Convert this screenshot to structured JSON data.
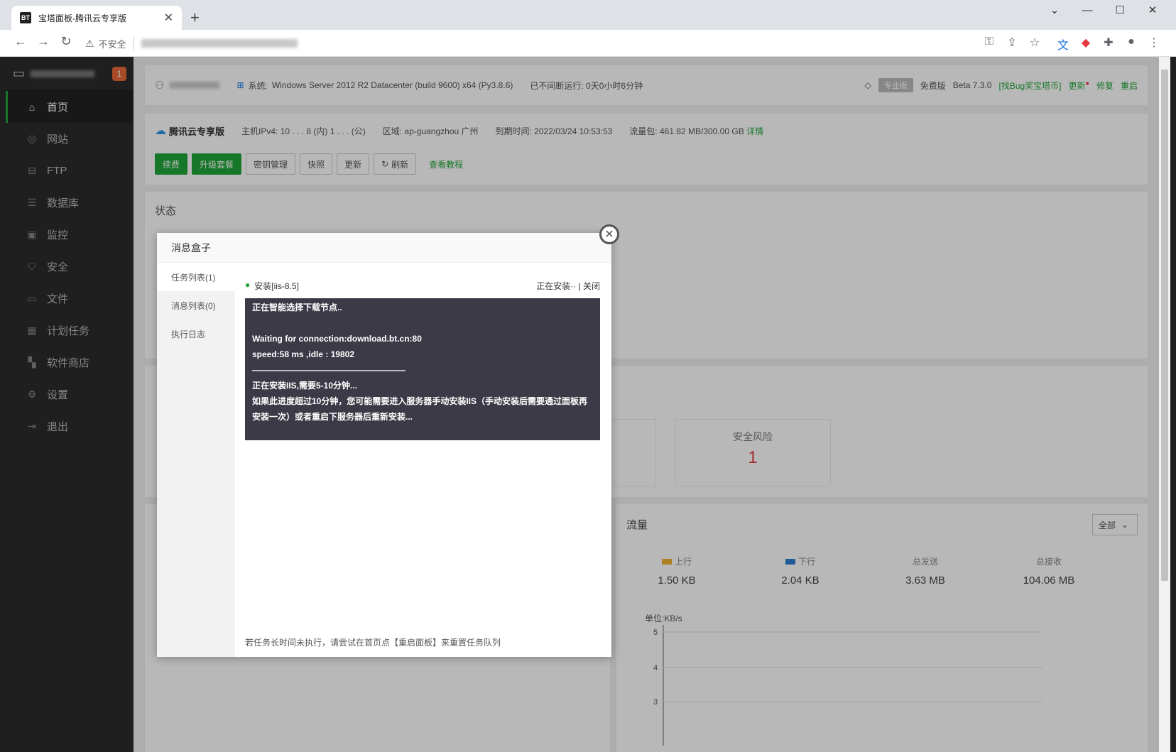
{
  "browser": {
    "tab_title": "宝塔面板-腾讯云专享版",
    "favicon_text": "BT",
    "insecure_label": "不安全"
  },
  "sidebar": {
    "badge": "1",
    "items": [
      {
        "label": "首页",
        "icon": "home-icon"
      },
      {
        "label": "网站",
        "icon": "globe-icon"
      },
      {
        "label": "FTP",
        "icon": "ftp-icon"
      },
      {
        "label": "数据库",
        "icon": "database-icon"
      },
      {
        "label": "监控",
        "icon": "monitor-icon"
      },
      {
        "label": "安全",
        "icon": "shield-icon"
      },
      {
        "label": "文件",
        "icon": "folder-icon"
      },
      {
        "label": "计划任务",
        "icon": "calendar-icon"
      },
      {
        "label": "软件商店",
        "icon": "grid-icon"
      },
      {
        "label": "设置",
        "icon": "gear-icon"
      },
      {
        "label": "退出",
        "icon": "logout-icon"
      }
    ]
  },
  "header": {
    "system_label": "系统:",
    "system_value": "Windows Server 2012 R2 Datacenter (build 9600) x64 (Py3.8.6)",
    "uptime": "已不间断运行: 0天0小时6分钟",
    "pro_badge": "专业版",
    "edition": "免费版",
    "version": "Beta  7.3.0",
    "bug_link": "[找Bug奖宝塔币]",
    "update": "更新",
    "repair": "修复",
    "restart": "重启"
  },
  "info": {
    "brand": "腾讯云专享版",
    "ip_label": "主机IPv4:",
    "ip_inner": "10 . . . 8 (内)",
    "ip_public": "1 . . . (公)",
    "region": "区域: ap-guangzhou 广州",
    "expire": "到期时间: 2022/03/24 10:53:53",
    "traffic": "流量包: 461.82 MB/300.00 GB",
    "detail_link": "详情",
    "buttons": [
      "续费",
      "升级套餐",
      "密钥管理",
      "快照",
      "更新",
      "刷新"
    ],
    "tutorial_link": "查看教程"
  },
  "status": {
    "title": "状态"
  },
  "overview": {
    "risk_label": "安全风险",
    "risk_value": "1"
  },
  "traffic": {
    "title": "流量",
    "select_value": "全部",
    "stats": [
      {
        "label": "上行",
        "value": "1.50 KB",
        "color": "#f0b233"
      },
      {
        "label": "下行",
        "value": "2.04 KB",
        "color": "#2b80d1"
      },
      {
        "label": "总发送",
        "value": "3.63 MB"
      },
      {
        "label": "总接收",
        "value": "104.06 MB"
      }
    ],
    "unit": "单位:KB/s",
    "y_ticks": [
      "5",
      "4",
      "3"
    ]
  },
  "dialog": {
    "title": "消息盒子",
    "tabs": [
      "任务列表(1)",
      "消息列表(0)",
      "执行日志"
    ],
    "task_name": "安装[iis-8.5]",
    "task_status": "正在安装··",
    "task_close": "| 关闭",
    "console_lines": [
      "正在智能选择下载节点..",
      "",
      "Waiting for connection:download.bt.cn:80",
      "speed:58 ms ,idle : 19802",
      "——————————————————",
      "正在安装IIS,需要5-10分钟...",
      "如果此进度超过10分钟，您可能需要进入服务器手动安装IIS（手动安装后需要通过面板再安装一次）或者重启下服务器后重新安装..."
    ],
    "footer": "若任务长时间未执行，请尝试在首页点【重启面板】来重置任务队列"
  }
}
